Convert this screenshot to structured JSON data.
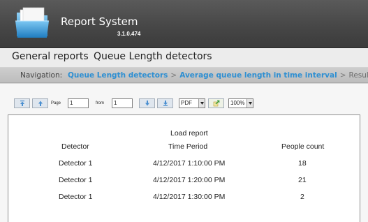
{
  "app": {
    "title": "Report System",
    "version": "3.1.0.474",
    "logo_icon": "folder-icon"
  },
  "menu": {
    "items": [
      {
        "label": "General reports"
      },
      {
        "label": "Queue Length detectors"
      }
    ]
  },
  "breadcrumb": {
    "prefix": "Navigation:",
    "links": [
      "Queue Length detectors",
      "Average queue length in time interval"
    ],
    "separator": ">",
    "current": "Result",
    "link_color": "#2e8fd2"
  },
  "toolbar": {
    "first_page_icon": "first-page-icon",
    "prev_page_icon": "previous-page-icon",
    "page_label": "Page",
    "page_value": "1",
    "from_label": "from",
    "total_pages": "1",
    "next_page_icon": "next-page-icon",
    "last_page_icon": "last-page-icon",
    "export_format": "PDF",
    "export_icon": "export-icon",
    "zoom": "100%"
  },
  "report": {
    "title": "Load report",
    "columns": [
      "Detector",
      "Time Period",
      "People count"
    ],
    "rows": [
      [
        "Detector 1",
        "4/12/2017 1:10:00 PM",
        "18"
      ],
      [
        "Detector 1",
        "4/12/2017 1:20:00 PM",
        "21"
      ],
      [
        "Detector 1",
        "4/12/2017 1:30:00 PM",
        "2"
      ]
    ]
  }
}
